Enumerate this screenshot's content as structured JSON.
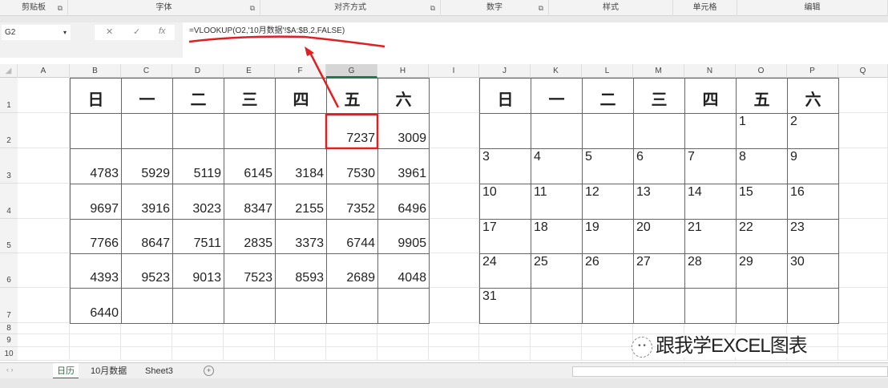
{
  "ribbon": {
    "groups": [
      "剪贴板",
      "字体",
      "对齐方式",
      "数字",
      "样式",
      "单元格",
      "编辑"
    ]
  },
  "formula_bar": {
    "name_box": "G2",
    "cancel": "✕",
    "enter": "✓",
    "fx": "fx",
    "formula": "=VLOOKUP(O2,'10月数据'!$A:$B,2,FALSE)"
  },
  "columns": [
    "A",
    "B",
    "C",
    "D",
    "E",
    "F",
    "G",
    "H",
    "I",
    "J",
    "K",
    "L",
    "M",
    "N",
    "O",
    "P",
    "Q"
  ],
  "selected_column": "G",
  "rows": [
    "1",
    "2",
    "3",
    "4",
    "5",
    "6",
    "7",
    "8",
    "9",
    "10"
  ],
  "weekdays": [
    "日",
    "一",
    "二",
    "三",
    "四",
    "五",
    "六"
  ],
  "left_table": [
    [
      "",
      "",
      "",
      "",
      "",
      "7237",
      "3009"
    ],
    [
      "4783",
      "5929",
      "5119",
      "6145",
      "3184",
      "7530",
      "3961"
    ],
    [
      "9697",
      "3916",
      "3023",
      "8347",
      "2155",
      "7352",
      "6496"
    ],
    [
      "7766",
      "8647",
      "7511",
      "2835",
      "3373",
      "6744",
      "9905"
    ],
    [
      "4393",
      "9523",
      "9013",
      "7523",
      "8593",
      "2689",
      "4048"
    ],
    [
      "6440",
      "",
      "",
      "",
      "",
      "",
      ""
    ]
  ],
  "right_table": [
    [
      "",
      "",
      "",
      "",
      "",
      "1",
      "2"
    ],
    [
      "3",
      "4",
      "5",
      "6",
      "7",
      "8",
      "9"
    ],
    [
      "10",
      "11",
      "12",
      "13",
      "14",
      "15",
      "16"
    ],
    [
      "17",
      "18",
      "19",
      "20",
      "21",
      "22",
      "23"
    ],
    [
      "24",
      "25",
      "26",
      "27",
      "28",
      "29",
      "30"
    ],
    [
      "31",
      "",
      "",
      "",
      "",
      "",
      ""
    ]
  ],
  "sheet_tabs": [
    "日历",
    "10月数据",
    "Sheet3"
  ],
  "active_tab": "日历",
  "watermark": "跟我学EXCEL图表",
  "colors": {
    "annotation": "#e02020",
    "accent": "#217346"
  }
}
